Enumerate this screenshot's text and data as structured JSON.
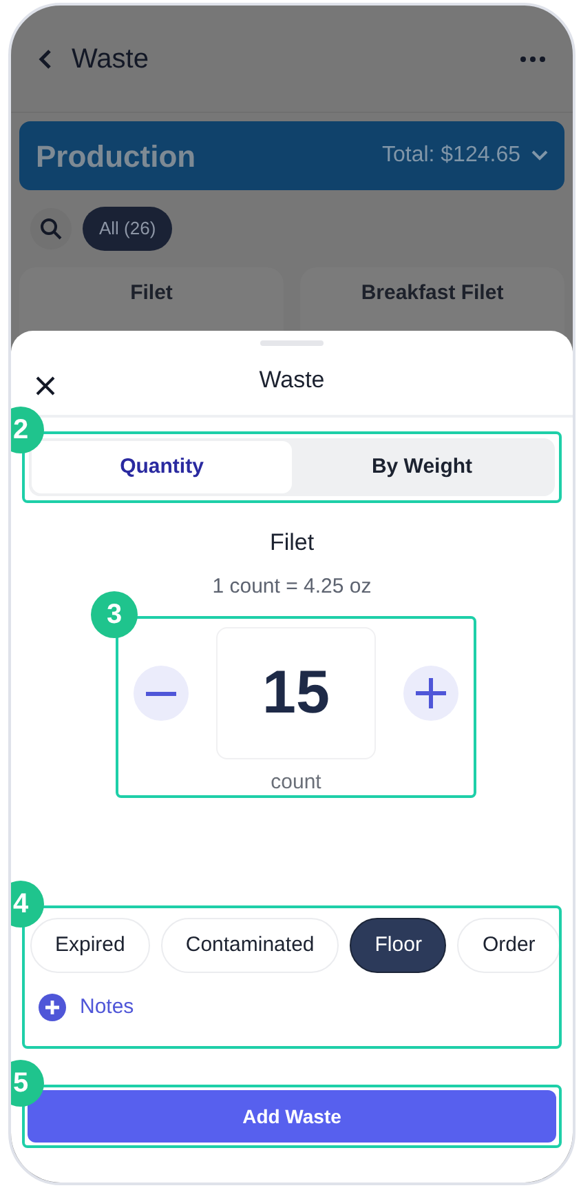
{
  "background_screen": {
    "title": "Waste",
    "banner": {
      "title": "Production",
      "total": "Total: $124.65"
    },
    "filter_chips": [
      {
        "label": "All (26)",
        "selected": true
      }
    ],
    "cards": [
      {
        "title": "Filet"
      },
      {
        "title": "Breakfast Filet"
      }
    ]
  },
  "sheet": {
    "title": "Waste",
    "mode_tabs": [
      {
        "label": "Quantity",
        "selected": true
      },
      {
        "label": "By Weight",
        "selected": false
      }
    ],
    "item": {
      "name": "Filet",
      "conversion": "1 count = 4.25 oz"
    },
    "stepper": {
      "value": "15",
      "unit": "count"
    },
    "reasons": [
      {
        "label": "Expired",
        "selected": false
      },
      {
        "label": "Contaminated",
        "selected": false
      },
      {
        "label": "Floor",
        "selected": true
      },
      {
        "label": "Order",
        "selected": false
      }
    ],
    "notes_link": "Notes",
    "submit_button": "Add Waste",
    "callouts": {
      "mode_tabs": "2",
      "stepper": "3",
      "reasons": "4",
      "submit": "5"
    }
  }
}
